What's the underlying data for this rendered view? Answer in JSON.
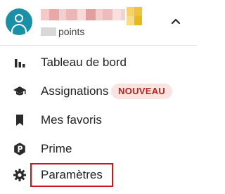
{
  "profile": {
    "points_label": "points",
    "username_redacted": true
  },
  "menu": {
    "items": [
      {
        "label": "Tableau de bord",
        "icon": "bar-chart-icon"
      },
      {
        "label": "Assignations",
        "icon": "graduation-cap-icon",
        "badge": "NOUVEAU"
      },
      {
        "label": "Mes favoris",
        "icon": "bookmark-icon"
      },
      {
        "label": "Prime",
        "icon": "prime-badge-icon"
      },
      {
        "label": "Paramètres",
        "icon": "gear-icon",
        "highlighted": true
      }
    ]
  },
  "colors": {
    "avatar_bg": "#1b8fa6",
    "badge_bg": "#fbe3df",
    "badge_text": "#b3261e",
    "highlight_border": "#d0121b"
  }
}
